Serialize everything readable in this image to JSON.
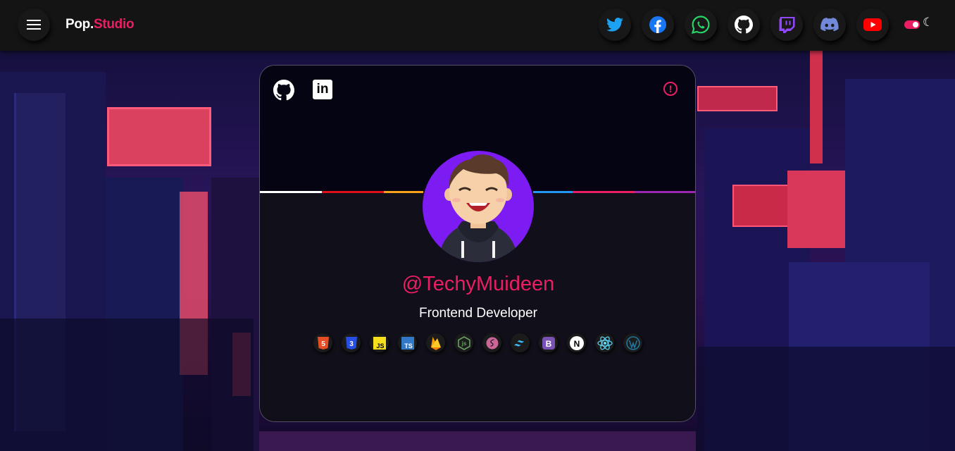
{
  "brand": {
    "part1": "Pop.",
    "part2": "Studio"
  },
  "nav": {
    "social": [
      {
        "icon": "twitter-icon",
        "color": "#1da1f2"
      },
      {
        "icon": "facebook-icon",
        "color": "#1877f2"
      },
      {
        "icon": "whatsapp-icon",
        "color": "#25d366"
      },
      {
        "icon": "github-icon",
        "color": "#ffffff"
      },
      {
        "icon": "twitch-icon",
        "color": "#9146ff"
      },
      {
        "icon": "discord-icon",
        "color": "#7289da"
      },
      {
        "icon": "youtube-icon",
        "color": "#ff0000"
      }
    ],
    "theme_toggle": {
      "icon": "moon-icon",
      "accent": "#e91e63"
    }
  },
  "profile": {
    "handle": "@TechyMuideen",
    "role": "Frontend Developer",
    "avatar_icon": "avatar-icon",
    "links": [
      {
        "icon": "github-icon"
      },
      {
        "icon": "linkedin-icon",
        "text": "in"
      }
    ],
    "info_icon": "info-icon",
    "stack": [
      {
        "icon": "html5-icon",
        "text": "5",
        "color": "#e44d26"
      },
      {
        "icon": "css3-icon",
        "text": "3",
        "color": "#264de4"
      },
      {
        "icon": "javascript-icon",
        "text": "JS",
        "color": "#f7df1e"
      },
      {
        "icon": "typescript-icon",
        "text": "TS",
        "color": "#3178c6"
      },
      {
        "icon": "firebase-icon",
        "color": "#ffca28"
      },
      {
        "icon": "nodejs-icon",
        "text": "js",
        "color": "#68a063"
      },
      {
        "icon": "sass-icon",
        "color": "#cc6699"
      },
      {
        "icon": "tailwind-icon",
        "color": "#38bdf8"
      },
      {
        "icon": "bootstrap-icon",
        "text": "B",
        "color": "#7952b3"
      },
      {
        "icon": "nextjs-icon",
        "text": "N",
        "color": "#000000"
      },
      {
        "icon": "react-icon",
        "color": "#61dafb"
      },
      {
        "icon": "wordpress-icon",
        "color": "#21759b"
      }
    ]
  },
  "accent": "#e91e63"
}
